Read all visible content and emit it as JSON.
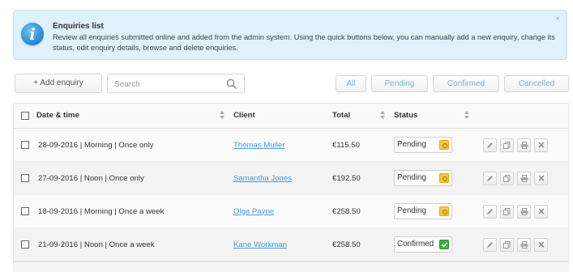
{
  "info": {
    "title": "Enquiries list",
    "text": "Review all enquiries submitted online and added from the admin system. Using the quick buttons below, you can manually add a new enquiry, change its status, edit enquiry details, browse and delete enquiries.",
    "close_symbol": "×",
    "icon_letter": "i"
  },
  "toolbar": {
    "add_label": "+ Add enquiry",
    "search_placeholder": "Search"
  },
  "filters": {
    "all": "All",
    "pending": "Pending",
    "confirmed": "Confirmed",
    "cancelled": "Cancelled"
  },
  "table": {
    "headers": {
      "date": "Date & time",
      "client": "Client",
      "total": "Total",
      "status": "Status"
    },
    "rows": [
      {
        "date": "28-09-2016 | Morning | Once only",
        "client": "Thomas Muller",
        "total": "€115.50",
        "status": "Pending"
      },
      {
        "date": "27-09-2016 | Noon | Once only",
        "client": "Samantha Jones",
        "total": "€192.50",
        "status": "Pending"
      },
      {
        "date": "18-09-2016 | Morning | Once a week",
        "client": "Olga Payne",
        "total": "€258.50",
        "status": "Pending"
      },
      {
        "date": "21-09-2016 | Noon | Once a week",
        "client": "Kane Workman",
        "total": "€258.50",
        "status": "Confirmed"
      }
    ]
  },
  "icons": {
    "info": "info-icon",
    "search": "search-icon",
    "sort": "sort-icon",
    "edit": "pencil-icon",
    "copy": "copy-icon",
    "print": "print-icon",
    "delete": "close-icon"
  },
  "colors": {
    "info_bg": "#dff1fa",
    "link": "#4a9ad6",
    "filter_text": "#7fb0d4",
    "pending_badge": "#f7c948",
    "confirmed_badge": "#3fae49"
  }
}
